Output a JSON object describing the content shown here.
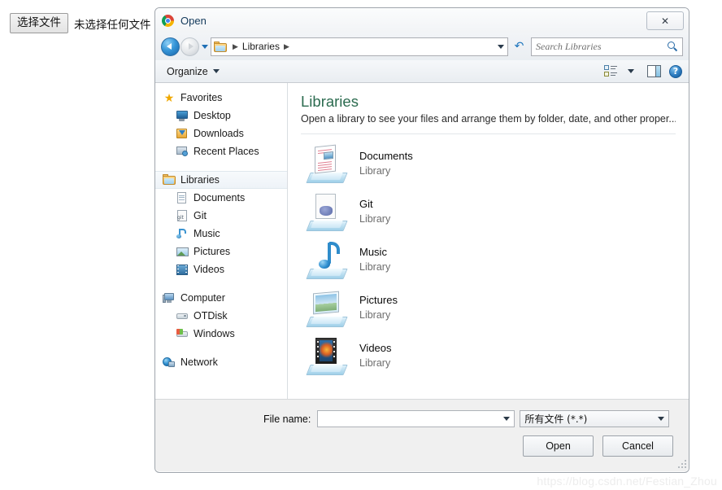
{
  "page": {
    "file_input": {
      "button_label": "选择文件",
      "status_text": "未选择任何文件"
    },
    "watermark": "https://blog.csdn.net/Festian_Zhou"
  },
  "dialog": {
    "title": "Open",
    "app_icon": "chrome-icon",
    "close_label": "✕",
    "nav": {
      "back_icon": "back-arrow-icon",
      "forward_icon": "forward-arrow-icon",
      "history_icon": "chevron-down-icon",
      "breadcrumb": [
        "Libraries"
      ],
      "refresh_icon": "refresh-icon",
      "search_placeholder": "Search Libraries",
      "search_value": "",
      "search_icon": "search-icon"
    },
    "toolbar": {
      "organize_label": "Organize",
      "organize_caret_icon": "chevron-down-icon",
      "views_icon": "change-view-icon",
      "views_caret_icon": "chevron-down-icon",
      "preview_pane_icon": "preview-pane-icon",
      "help_icon": "help-icon",
      "help_glyph": "?"
    },
    "sidebar": {
      "groups": [
        {
          "header": {
            "label": "Favorites",
            "icon": "star-icon"
          },
          "items": [
            {
              "label": "Desktop",
              "icon": "monitor-icon"
            },
            {
              "label": "Downloads",
              "icon": "downloads-folder-icon"
            },
            {
              "label": "Recent Places",
              "icon": "recent-places-icon"
            }
          ]
        },
        {
          "header": {
            "label": "Libraries",
            "icon": "libraries-folder-icon",
            "selected": true
          },
          "items": [
            {
              "label": "Documents",
              "icon": "document-icon"
            },
            {
              "label": "Git",
              "icon": "git-icon"
            },
            {
              "label": "Music",
              "icon": "music-note-icon"
            },
            {
              "label": "Pictures",
              "icon": "picture-icon"
            },
            {
              "label": "Videos",
              "icon": "filmstrip-icon"
            }
          ]
        },
        {
          "header": {
            "label": "Computer",
            "icon": "computer-icon"
          },
          "items": [
            {
              "label": "OTDisk",
              "icon": "disk-drive-icon"
            },
            {
              "label": "Windows",
              "icon": "windows-drive-icon"
            }
          ]
        },
        {
          "header": {
            "label": "Network",
            "icon": "network-globe-icon"
          },
          "items": []
        }
      ]
    },
    "content": {
      "heading": "Libraries",
      "subheading": "Open a library to see your files and arrange them by folder, date, and other proper...",
      "items": [
        {
          "name": "Documents",
          "kind": "Library",
          "icon": "documents-library-icon"
        },
        {
          "name": "Git",
          "kind": "Library",
          "icon": "git-library-icon"
        },
        {
          "name": "Music",
          "kind": "Library",
          "icon": "music-library-icon"
        },
        {
          "name": "Pictures",
          "kind": "Library",
          "icon": "pictures-library-icon"
        },
        {
          "name": "Videos",
          "kind": "Library",
          "icon": "videos-library-icon"
        }
      ]
    },
    "footer": {
      "filename_label": "File name:",
      "filename_value": "",
      "filetype_value": "所有文件 (*.*)",
      "open_label": "Open",
      "cancel_label": "Cancel"
    }
  },
  "colors": {
    "heading": "#2b6b4f",
    "accent": "#2f8fd0",
    "dialog_bg": "#f0f0f0"
  }
}
